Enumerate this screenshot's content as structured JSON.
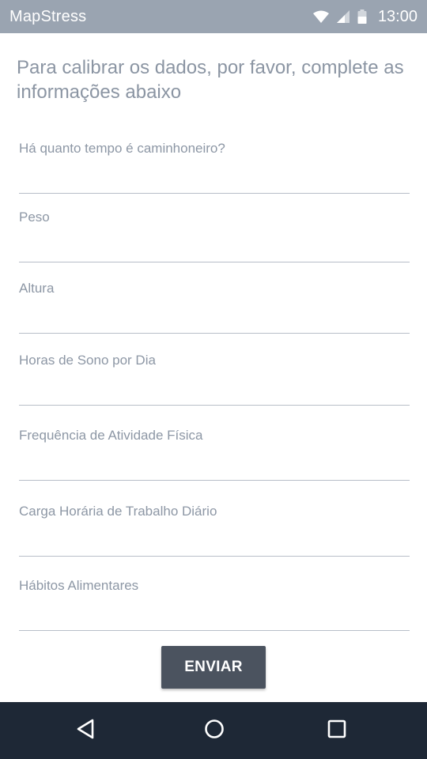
{
  "status_bar": {
    "app_name": "MapStress",
    "time": "13:00",
    "icons": [
      "wifi-icon",
      "signal-icon",
      "battery-icon"
    ]
  },
  "form": {
    "intro": "Para calibrar os dados, por favor, complete as informações abaixo",
    "fields": [
      {
        "label": "Há quanto tempo é caminhoneiro?",
        "value": ""
      },
      {
        "label": "Peso",
        "value": ""
      },
      {
        "label": "Altura",
        "value": ""
      },
      {
        "label": "Horas de Sono por Dia",
        "value": ""
      },
      {
        "label": "Frequência de Atividade Física",
        "value": ""
      },
      {
        "label": "Carga Horária de Trabalho Diário",
        "value": ""
      },
      {
        "label": "Hábitos Alimentares",
        "value": ""
      }
    ],
    "submit_label": "ENVIAR"
  },
  "navigation": {
    "buttons": [
      "back-icon",
      "home-icon",
      "recents-icon"
    ]
  },
  "colors": {
    "status_bar": "#9aa4b1",
    "text_muted": "#8b95a3",
    "field_line": "#b8bec8",
    "button": "#4b535f",
    "nav_bar": "#1e2836"
  }
}
